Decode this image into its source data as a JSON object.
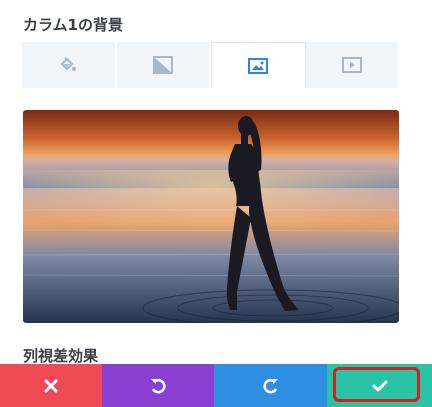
{
  "panel": {
    "title": "カラム1の背景",
    "subsection_title": "列視差効果"
  },
  "tabs": [
    {
      "icon": "paint-bucket-icon",
      "active": false
    },
    {
      "icon": "gradient-icon",
      "active": false
    },
    {
      "icon": "image-icon",
      "active": true
    },
    {
      "icon": "video-icon",
      "active": false
    }
  ],
  "preview": {
    "icon": "background-image-preview"
  },
  "actions": {
    "close_icon": "close-icon",
    "undo_icon": "undo-icon",
    "redo_icon": "redo-icon",
    "save_icon": "check-icon"
  },
  "colors": {
    "close": "#ef4a55",
    "undo": "#8b3fd3",
    "redo": "#2d8ee2",
    "save": "#29c4a6",
    "highlight": "#d81e1e",
    "tab_icon": "#a9b7c6",
    "tab_icon_active": "#2b87da"
  }
}
